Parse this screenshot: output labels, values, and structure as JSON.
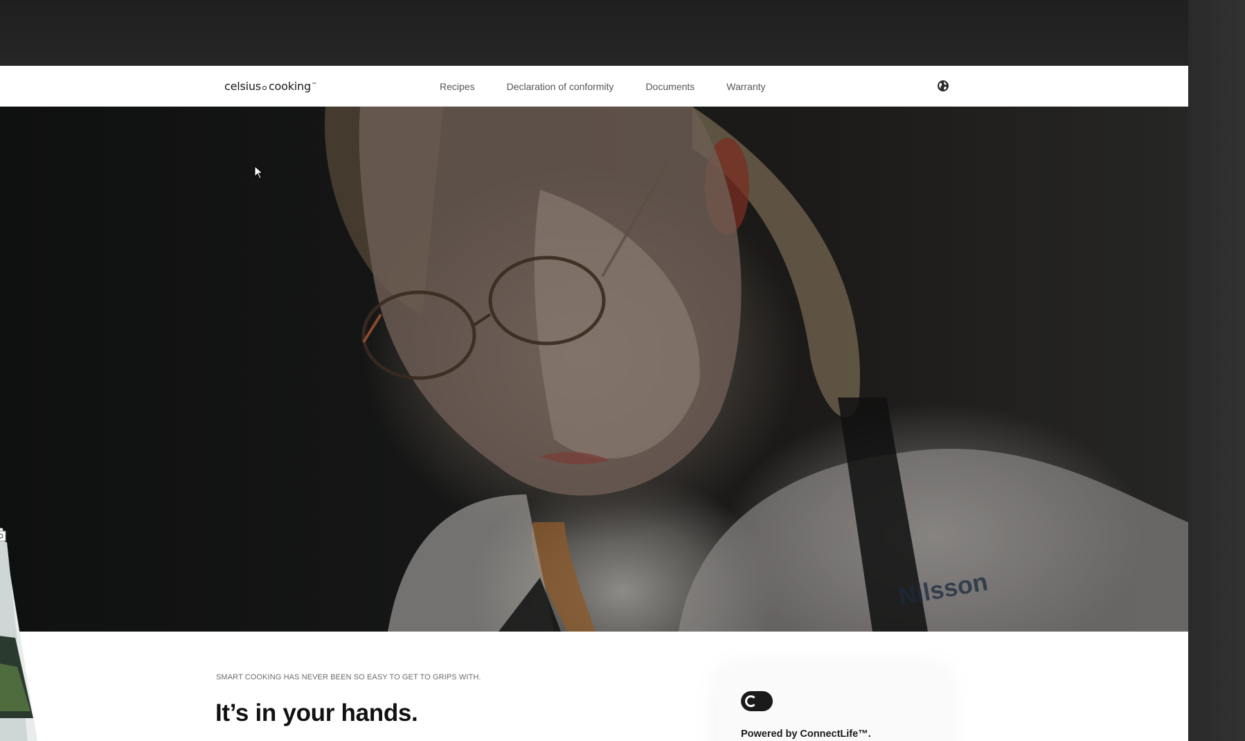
{
  "logo": {
    "word1": "celsius",
    "word2": "cooking",
    "tm": "™"
  },
  "nav": {
    "items": [
      {
        "label": "Recipes"
      },
      {
        "label": "Declaration of conformity"
      },
      {
        "label": "Documents"
      },
      {
        "label": "Warranty"
      }
    ],
    "language_icon": "globe-icon"
  },
  "hero": {
    "apron_text": "Nilsson"
  },
  "intro": {
    "eyebrow": "SMART COOKING HAS NEVER BEEN SO EASY TO GET TO GRIPS WITH.",
    "headline": "It’s in your hands."
  },
  "connectlife": {
    "toggle_icon": "toggle-icon",
    "powered_by": "Powered by ConnectLife™."
  }
}
